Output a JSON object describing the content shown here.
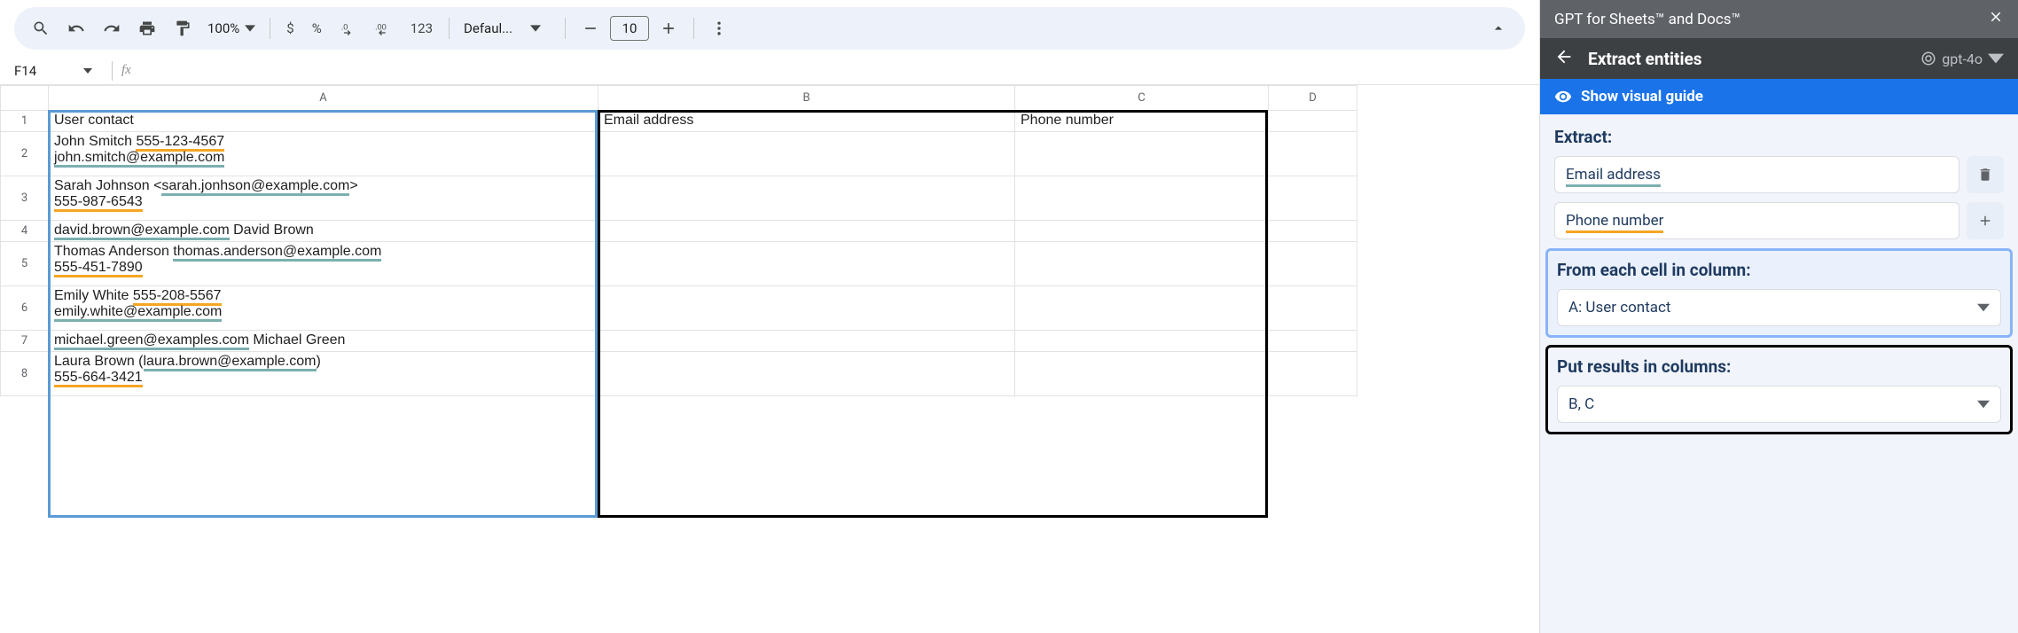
{
  "toolbar": {
    "zoom": "100%",
    "currency": "$",
    "percent": "%",
    "dec_dec": ".0",
    "inc_dec": ".00",
    "num123": "123",
    "font": "Defaul...",
    "font_size": "10"
  },
  "namebox": {
    "ref": "F14"
  },
  "columns": {
    "A": "A",
    "B": "B",
    "C": "C",
    "D": "D"
  },
  "headers": {
    "A": "User contact",
    "B": "Email address",
    "C": "Phone number"
  },
  "rows": [
    {
      "n": "1"
    },
    {
      "n": "2",
      "a_plain1": "John Smitch ",
      "a_phone": "555-123-4567",
      "a_email": "john.smitch@example.com"
    },
    {
      "n": "3",
      "a_plain1": "Sarah Johnson <",
      "a_email": "sarah.jonhson@example.com",
      "a_plain2": ">",
      "a_phone": "555-987-6543"
    },
    {
      "n": "4",
      "a_email": "david.brown@example.com",
      "a_plain2": " David Brown"
    },
    {
      "n": "5",
      "a_plain1": "Thomas Anderson ",
      "a_email": "thomas.anderson@example.com",
      "a_phone": "555-451-7890"
    },
    {
      "n": "6",
      "a_plain1": "Emily White ",
      "a_phone": "555-208-5567",
      "a_email": "emily.white@example.com"
    },
    {
      "n": "7",
      "a_email": "michael.green@examples.com",
      "a_plain2": " Michael Green"
    },
    {
      "n": "8",
      "a_plain1": "Laura Brown (",
      "a_email": "laura.brown@example.com",
      "a_plain2": ")",
      "a_phone": "555-664-3421"
    }
  ],
  "sidebar": {
    "title": "GPT for Sheets™ and Docs™",
    "nav_title": "Extract entities",
    "model": "gpt-4o",
    "guide": "Show visual guide",
    "extract_label": "Extract:",
    "extract_1": "Email address",
    "extract_2": "Phone number",
    "from_label": "From each cell in column:",
    "from_value": "A: User contact",
    "put_label": "Put results in columns:",
    "put_value": "B, C"
  }
}
